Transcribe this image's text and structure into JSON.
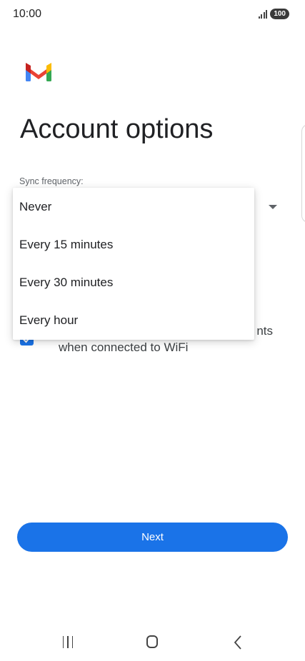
{
  "status_bar": {
    "time": "10:00",
    "battery": "100",
    "icons": [
      "signal-icon",
      "battery-icon"
    ]
  },
  "app": {
    "logo": "gmail-logo-icon"
  },
  "page": {
    "title": "Account options"
  },
  "sync": {
    "label": "Sync frequency:"
  },
  "menu": {
    "items": [
      {
        "label": "Never"
      },
      {
        "label": "Every 15 minutes"
      },
      {
        "label": "Every 30 minutes"
      },
      {
        "label": "Every hour"
      }
    ]
  },
  "attachments": {
    "checked": true,
    "line1_visible": "nts",
    "line2": "when connected to WiFi"
  },
  "actions": {
    "next_label": "Next"
  },
  "colors": {
    "accent": "#1a73e8",
    "gmail_red": "#ea4335",
    "gmail_blue": "#4285f4",
    "gmail_green": "#34a853",
    "gmail_yellow": "#fbbc04"
  },
  "nav_bar": {
    "icons": [
      "recents-icon",
      "home-icon",
      "back-icon"
    ]
  }
}
